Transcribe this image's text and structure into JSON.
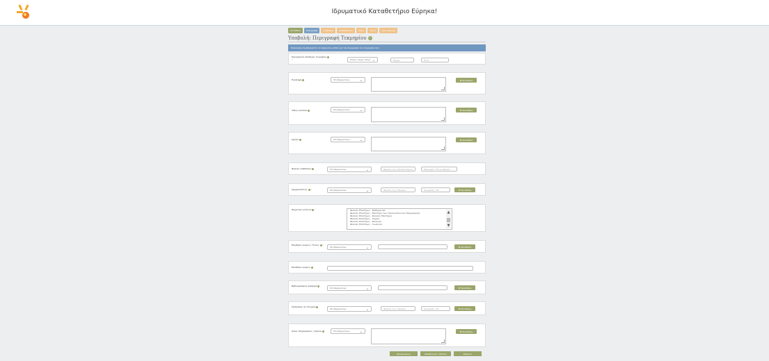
{
  "header": {
    "title": "Ιδρυματικό Καταθετήριο Εύρηκα!"
  },
  "tabs": [
    {
      "label": "Κατάθεση"
    },
    {
      "label": "Περιγραφή"
    },
    {
      "label": "Ανέβασμα"
    },
    {
      "label": "Επιβεβαίωση"
    },
    {
      "label": "Άδεια"
    },
    {
      "label": "Τέλος"
    },
    {
      "label": "Ολοκλήρωση"
    }
  ],
  "page": {
    "heading": "Υποβολή: Περιγραφή Τεκμηρίου",
    "notice": "Παρακαλώ συμπληρώστε τα παρακάτω πεδία για την περιγραφή του τεκμηρίου σας"
  },
  "date_field": {
    "label": "Ημερομηνία αποδοχής τεκμηρίου",
    "month_prefix": "Μήνας",
    "month_value": "Χωρίς Μήνα",
    "day_label": "Ημέρα",
    "year_label": "Έτος"
  },
  "fields": {
    "lang_select_default": "Μη Εφαρμόσιμο",
    "add_label": "Προσθήκη",
    "abstract": "Περίληψη",
    "keywords": "Λέξεις-κλειδιά",
    "notes": "Σχόλιο",
    "publisher": "Φορέας επιβλέπων",
    "publisher_place1": "Φορέας (π.χ. Πανεπιστήμιο)",
    "publisher_place2": "Επωνυμία / ΤΣ για Φορέα",
    "sponsor": "Χρηματοδότης",
    "sponsor_place1": "Φορέας (π.χ. Ίδρυμα)",
    "sponsor_place2": "Ονομασία / ΤΣ",
    "subjects": "Θεματική ενότητα",
    "subject_items": [
      "Φυσικές Επιστήμες - Μαθηματικά",
      "Φυσικές Επιστήμες - Επιστήμη των Υπολογιστών και Πληροφορική",
      "Φυσικές Επιστήμες - Φυσικές Επιστήμες",
      "Φυσικές Επιστήμες - Χημεία",
      "Φυσικές Επιστήμες - Βιολογία",
      "Φυσικές Επιστήμες - Γεωλογία"
    ],
    "other_title": "Ελεύθερο κείμενο / Τίτλος",
    "description": "Ελεύθερο κείμενο",
    "bibliography": "Βιβλιογραφική αναφορά",
    "related": "Σύνδεσμος σε στοιχεία",
    "related_place1": "Φορέας (π.χ. Ίδρυμα)",
    "related_place2": "Ονομασία / ΤΣ",
    "other_notes": "Άλλες Πληροφορίες / Σχόλια"
  },
  "footer": {
    "prev": "Προηγούμενο",
    "save": "Αποθήκευση / Έξοδος",
    "next": "Επόμενο"
  },
  "colors": {
    "accent_green": "#9aa56a",
    "accent_blue": "#6f97c0",
    "accent_orange": "#f0c28a"
  }
}
